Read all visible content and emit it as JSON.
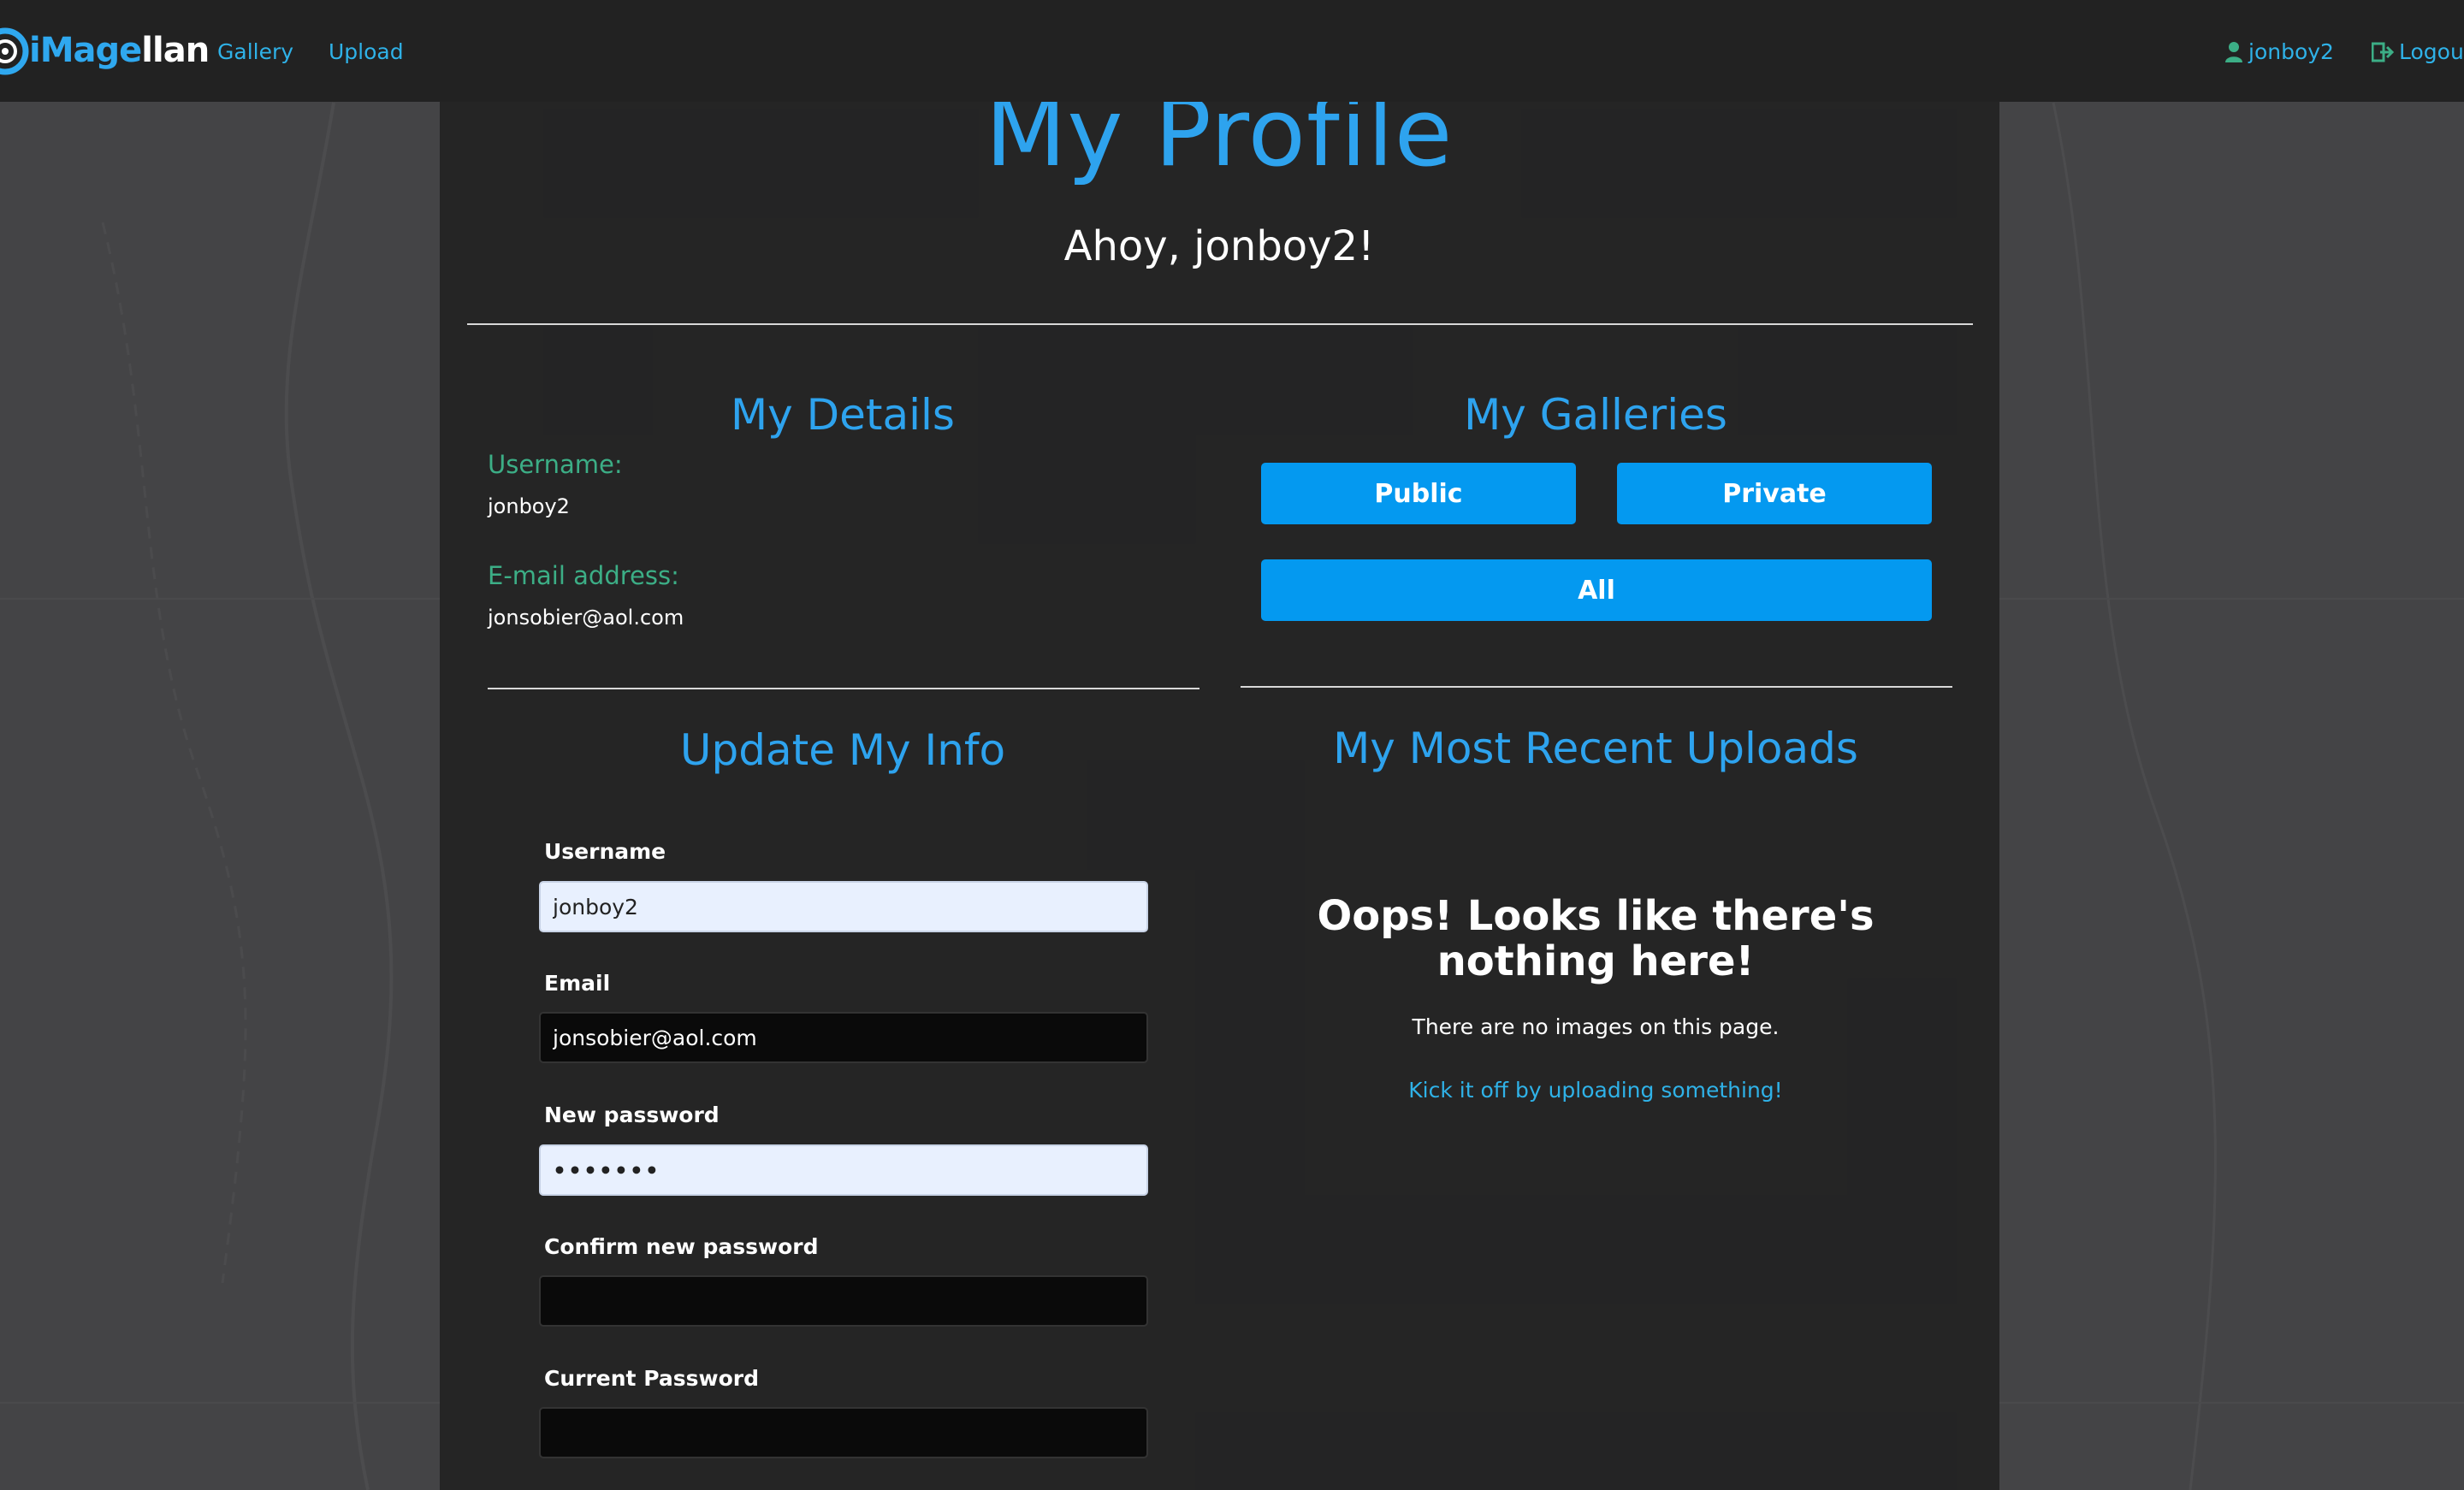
{
  "navbar": {
    "brand_prefix": "iMage",
    "brand_suffix": "llan",
    "links": [
      "Gallery",
      "Upload"
    ],
    "user_label": "jonboy2",
    "logout_label": "Logout"
  },
  "header": {
    "title": "My Profile",
    "greeting": "Ahoy, jonboy2!"
  },
  "details": {
    "title": "My Details",
    "username_label": "Username:",
    "username_value": "jonboy2",
    "email_label": "E-mail address:",
    "email_value": "jonsobier@aol.com"
  },
  "galleries": {
    "title": "My Galleries",
    "public_label": "Public",
    "private_label": "Private",
    "all_label": "All"
  },
  "update_form": {
    "title": "Update My Info",
    "username_label": "Username",
    "username_value": "jonboy2",
    "email_label": "Email",
    "email_value": "jonsobier@aol.com",
    "new_password_label": "New password",
    "new_password_value": "•••••••",
    "confirm_password_label": "Confirm new password",
    "confirm_password_value": "",
    "current_password_label": "Current Password",
    "current_password_value": ""
  },
  "recent_uploads": {
    "title": "My Most Recent Uploads",
    "empty_heading": "Oops! Looks like there's nothing here!",
    "empty_message": "There are no images on this page.",
    "empty_link": "Kick it off by uploading something!"
  },
  "colors": {
    "accent_blue": "#2ea3ee",
    "button_blue": "#0499f0",
    "label_green": "#3cae86",
    "navbar_bg": "#222222",
    "panel_bg": "#222222"
  }
}
